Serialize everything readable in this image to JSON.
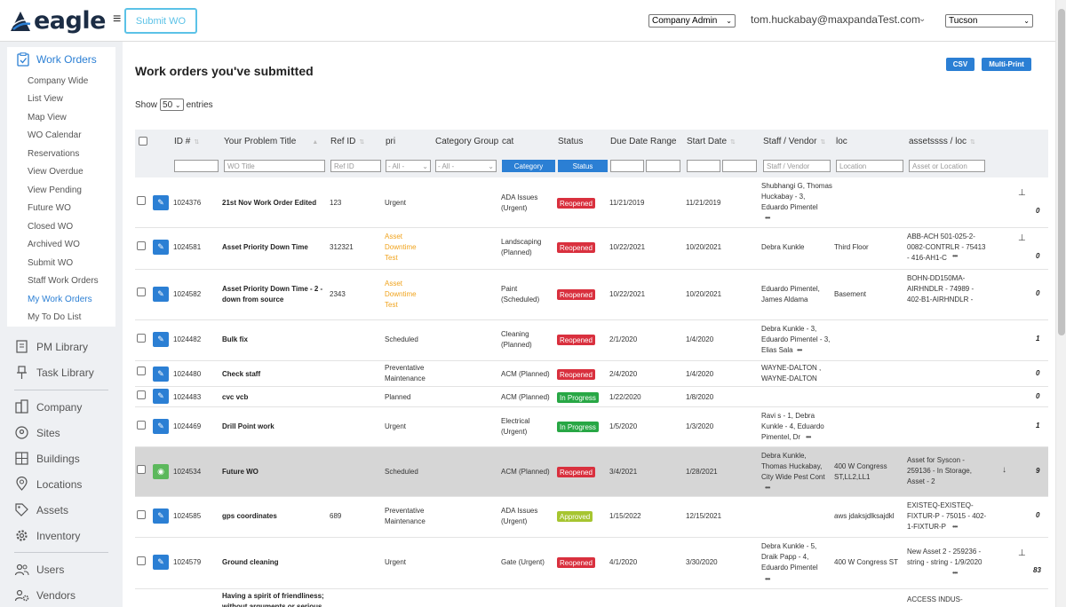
{
  "header": {
    "logo_text": "eagle",
    "submit_wo_label": "Submit WO",
    "role_select": "Company Admin",
    "user_email": "tom.huckabay@maxpandaTest.com",
    "location_select": "Tucson"
  },
  "sidebar": {
    "active_label": "Work Orders",
    "subitems": [
      "Company Wide",
      "List View",
      "Map View",
      "WO Calendar",
      "Reservations",
      "View Overdue",
      "View Pending",
      "Future WO",
      "Closed WO",
      "Archived WO",
      "Submit WO",
      "Staff Work Orders",
      "My Work Orders",
      "My To Do List"
    ],
    "pm_library": "PM Library",
    "task_library": "Task Library",
    "company": "Company",
    "sites": "Sites",
    "buildings": "Buildings",
    "locations": "Locations",
    "assets": "Assets",
    "inventory": "Inventory",
    "users": "Users",
    "vendors": "Vendors"
  },
  "main": {
    "title": "Work orders you've submitted",
    "csv_label": "CSV",
    "multiprint_label": "Multi-Print",
    "show_label": "Show",
    "entries_value": "50",
    "entries_label": "entries"
  },
  "table": {
    "headers": {
      "id": "ID #",
      "title": "Your Problem Title",
      "ref": "Ref ID",
      "pri": "pri",
      "catgroup": "Category Group",
      "cat": "cat",
      "status": "Status",
      "due": "Due Date Range",
      "start": "Start Date",
      "staff": "Staff / Vendor",
      "loc": "loc",
      "assets": "assetssss / loc"
    },
    "filters": {
      "title_ph": "WO Title",
      "ref_ph": "Ref ID",
      "pri_sel": "- All -",
      "catgroup_sel": "- All -",
      "category_btn": "Category",
      "status_btn": "Status",
      "staff_ph": "Staff / Vendor",
      "location_ph": "Location",
      "asset_ph": "Asset or Location"
    },
    "rows": [
      {
        "id": "1024376",
        "title": "21st Nov Work Order Edited",
        "ref": "123",
        "pri": "Urgent",
        "cat": "ADA Issues (Urgent)",
        "status": "Reopened",
        "due": "11/21/2019",
        "start": "11/21/2019",
        "staff": "Shubhangi G, Thomas Huckabay - 3, Eduardo Pimentel",
        "loc": "",
        "assets": "",
        "count": "0"
      },
      {
        "id": "1024581",
        "title": "Asset Priority Down Time",
        "ref": "312321",
        "pri": "Asset Downtime Test",
        "cat": "Landscaping (Planned)",
        "status": "Reopened",
        "due": "10/22/2021",
        "start": "10/20/2021",
        "staff": "Debra Kunkle",
        "loc": "Third Floor",
        "assets": "ABB-ACH 501-025-2-0082-CONTRLR - 75413 - 416-AH1-C",
        "count": "0"
      },
      {
        "id": "1024582",
        "title": "Asset Priority Down Time - 2 - down from source",
        "ref": "2343",
        "pri": "Asset Downtime Test",
        "cat": "Paint (Scheduled)",
        "status": "Reopened",
        "due": "10/22/2021",
        "start": "10/20/2021",
        "staff": "Eduardo Pimentel, James Aldama",
        "loc": "Basement",
        "assets": "BOHN-DD150MA-AIRHNDLR - 74989 - 402-B1-AIRHNDLR -",
        "count": "0"
      },
      {
        "id": "1024482",
        "title": "Bulk fix",
        "ref": "",
        "pri": "Scheduled",
        "cat": "Cleaning (Planned)",
        "status": "Reopened",
        "due": "2/1/2020",
        "start": "1/4/2020",
        "staff": "Debra Kunkle - 3, Eduardo Pimentel - 3, Elias Sala",
        "loc": "",
        "assets": "",
        "count": "1"
      },
      {
        "id": "1024480",
        "title": "Check staff",
        "ref": "",
        "pri": "Preventative Maintenance",
        "cat": "ACM (Planned)",
        "status": "Reopened",
        "due": "2/4/2020",
        "start": "1/4/2020",
        "staff": "WAYNE-DALTON , WAYNE-DALTON",
        "loc": "",
        "assets": "",
        "count": "0"
      },
      {
        "id": "1024483",
        "title": "cvc vcb",
        "ref": "",
        "pri": "Planned",
        "cat": "ACM (Planned)",
        "status": "In Progress",
        "due": "1/22/2020",
        "start": "1/8/2020",
        "staff": "",
        "loc": "",
        "assets": "",
        "count": "0"
      },
      {
        "id": "1024469",
        "title": "Drill Point work",
        "ref": "",
        "pri": "Urgent",
        "cat": "Electrical (Urgent)",
        "status": "In Progress",
        "due": "1/5/2020",
        "start": "1/3/2020",
        "staff": "Ravi s - 1, Debra Kunkle - 4, Eduardo Pimentel, Dr",
        "loc": "",
        "assets": "",
        "count": "1"
      },
      {
        "id": "1024534",
        "title": "Future WO",
        "ref": "",
        "pri": "Scheduled",
        "cat": "ACM (Planned)",
        "status": "Reopened",
        "due": "3/4/2021",
        "start": "1/28/2021",
        "staff": "Debra Kunkle, Thomas Huckabay, City Wide Pest Cont",
        "loc": "400 W Congress ST,LL2,LL1",
        "assets": "Asset for Syscon - 259136 - In Storage, Asset - 2",
        "count": "9"
      },
      {
        "id": "1024585",
        "title": "gps coordinates",
        "ref": "689",
        "pri": "Preventative Maintenance",
        "cat": "ADA Issues (Urgent)",
        "status": "Approved",
        "due": "1/15/2022",
        "start": "12/15/2021",
        "staff": "",
        "loc": "aws jdaksjdlksajdkl",
        "assets": "EXISTEQ-EXISTEQ-FIXTUR-P - 75015 - 402-1-FIXTUR-P",
        "count": "0"
      },
      {
        "id": "1024579",
        "title": "Ground cleaning",
        "ref": "",
        "pri": "Urgent",
        "cat": "Gate (Urgent)",
        "status": "Reopened",
        "due": "4/1/2020",
        "start": "3/30/2020",
        "staff": "Debra Kunkle - 5, Draik Papp - 4, Eduardo Pimentel",
        "loc": "400 W Congress ST",
        "assets": "New Asset 2 - 259236 - string - string - 1/9/2020",
        "count": "83"
      },
      {
        "id": "",
        "title": "Having a spirit of friendliness; without arguments or serious",
        "ref": "",
        "pri": "",
        "cat": "",
        "status": "",
        "due": "",
        "start": "",
        "staff": "",
        "loc": "",
        "assets": "ACCESS INDUS-",
        "count": ""
      }
    ]
  },
  "colors": {
    "accent": "#2b7fd4",
    "reopened": "#d9303e",
    "in_progress": "#28a745",
    "approved": "#a6c530",
    "priority_orange": "#f0a31d"
  }
}
